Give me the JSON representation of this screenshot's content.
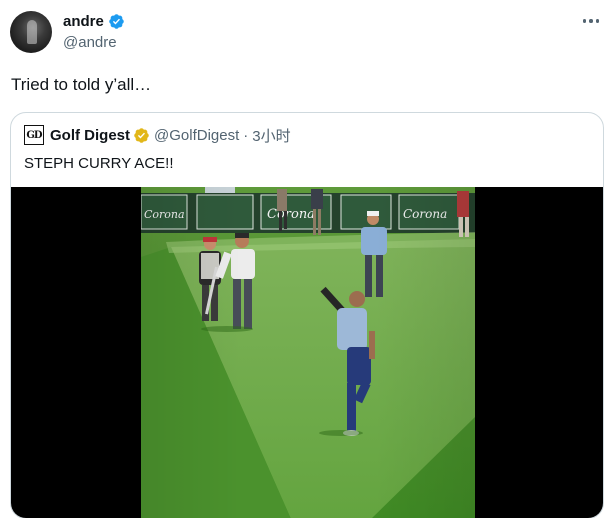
{
  "tweet": {
    "author": {
      "name": "andre",
      "handle": "@andre",
      "verified": true,
      "avatar_icon": "profile-photo"
    },
    "text": "Tried to told y’all…",
    "more_icon": "ellipsis-icon"
  },
  "quote": {
    "author": {
      "name": "Golf Digest",
      "handle": "@GolfDigest",
      "separator": "·",
      "time": "3小时",
      "avatar_text": "GD",
      "verified": "gold-business-badge"
    },
    "text": "STEPH CURRY ACE!!",
    "media": {
      "type": "video-still",
      "banners": [
        "Corona",
        "Corona",
        "Corona"
      ]
    }
  },
  "colors": {
    "verified_blue": "#1d9bf0",
    "business_gold": "#e2b719",
    "secondary_text": "#536471",
    "border": "#cfd9de"
  }
}
